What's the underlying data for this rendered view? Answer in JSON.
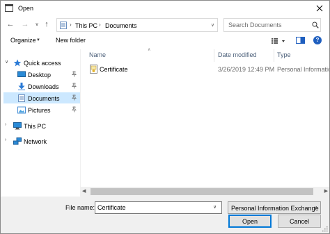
{
  "window": {
    "title": "Open"
  },
  "navigation": {
    "breadcrumb": [
      "This PC",
      "Documents"
    ],
    "search_placeholder": "Search Documents"
  },
  "toolbar": {
    "organize_label": "Organize",
    "new_folder_label": "New folder"
  },
  "nav_pane": {
    "items": [
      {
        "label": "Quick access",
        "icon": "star-icon",
        "expandable": true,
        "expanded": true,
        "pinned": false,
        "selected": false
      },
      {
        "label": "Desktop",
        "icon": "desktop-icon",
        "pinned": true,
        "selected": false
      },
      {
        "label": "Downloads",
        "icon": "download-arrow-icon",
        "pinned": true,
        "selected": false
      },
      {
        "label": "Documents",
        "icon": "documents-icon",
        "pinned": true,
        "selected": true
      },
      {
        "label": "Pictures",
        "icon": "pictures-icon",
        "pinned": true,
        "selected": false
      },
      {
        "label": "This PC",
        "icon": "computer-icon",
        "expandable": true,
        "expanded": false,
        "selected": false
      },
      {
        "label": "Network",
        "icon": "network-icon",
        "expandable": true,
        "expanded": false,
        "selected": false
      }
    ]
  },
  "file_list": {
    "columns": [
      "Name",
      "Date modified",
      "Type"
    ],
    "sorted_by": "Name",
    "rows": [
      {
        "name": "Certificate",
        "date_modified": "3/26/2019 12:49 PM",
        "type": "Personal Informatio",
        "icon": "certificate-icon"
      }
    ]
  },
  "footer": {
    "file_name_label": "File name:",
    "file_name_value": "Certificate",
    "file_type_value": "Personal Information Exchange",
    "open_label": "Open",
    "cancel_label": "Cancel"
  },
  "colors": {
    "selection": "#cce8ff",
    "primary_button_border": "#0078d7",
    "column_header_text": "#4c607a",
    "footer_background": "#f0f0f0"
  }
}
